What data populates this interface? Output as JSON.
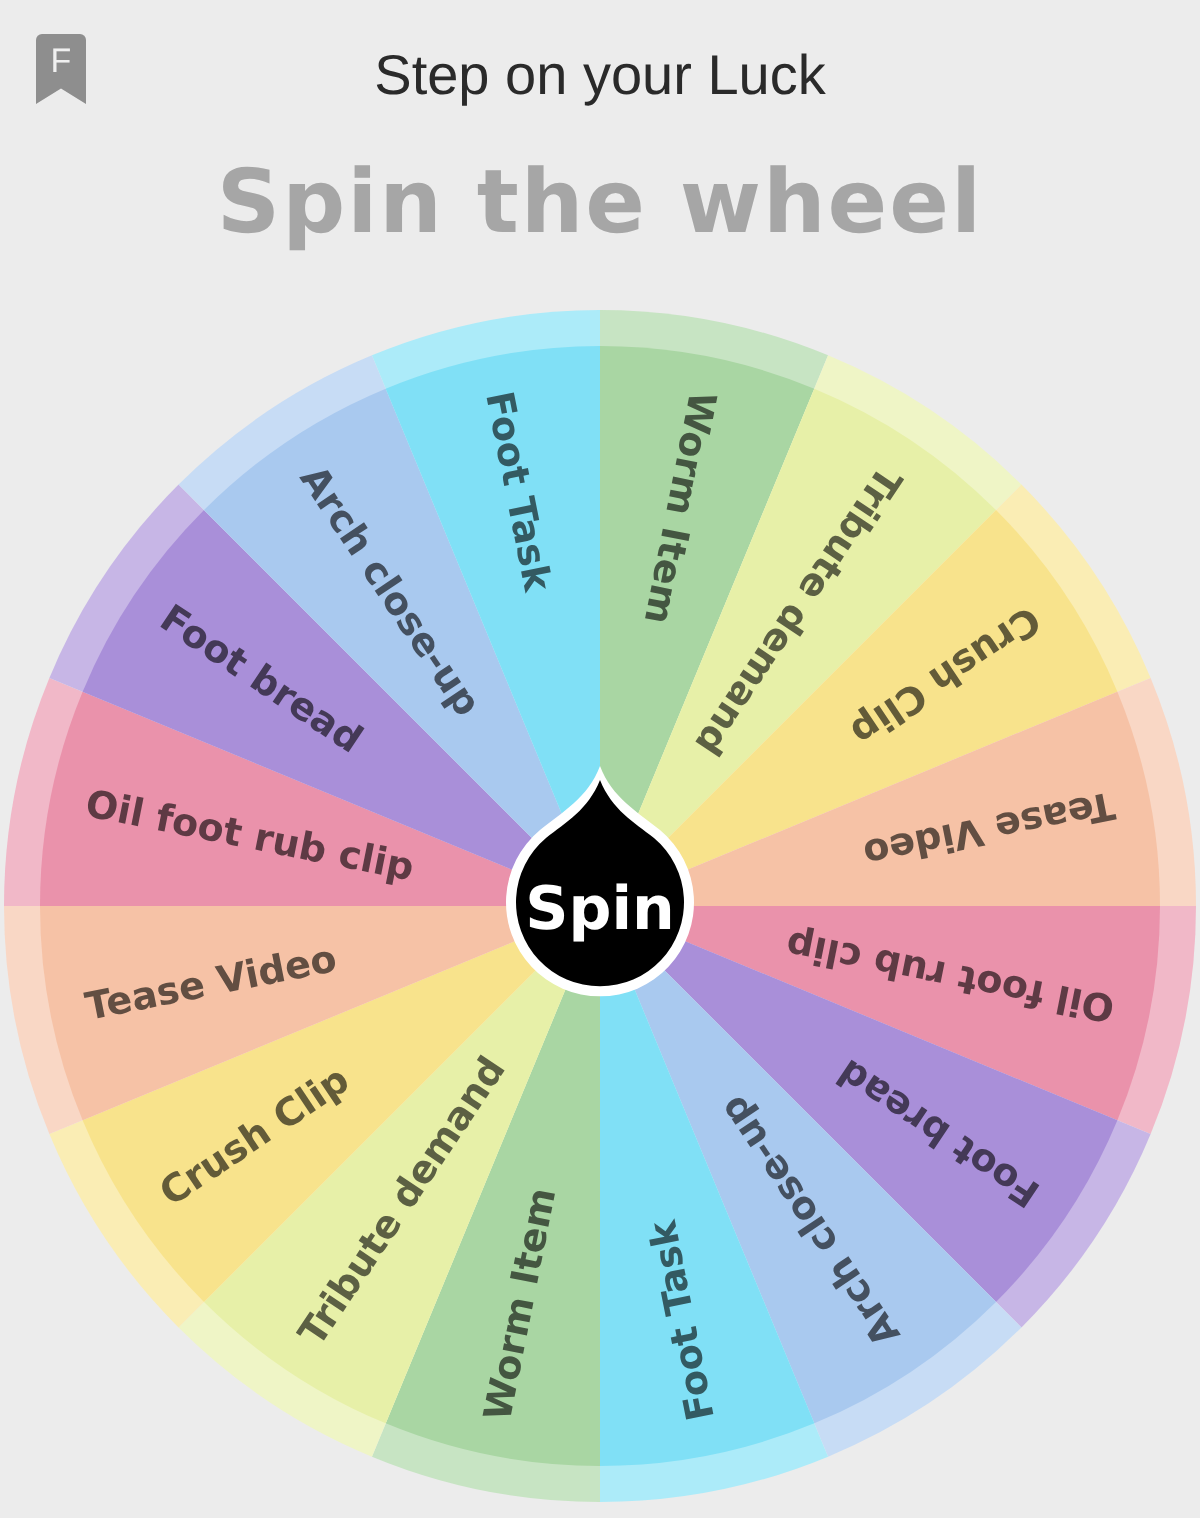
{
  "header": {
    "badge": "F",
    "title": "Step on your Luck"
  },
  "heading": "Spin the wheel",
  "wheel": {
    "button": "Spin",
    "segments": [
      {
        "label": "Worm Item",
        "color": "#a9d6a3"
      },
      {
        "label": "Tribute demand",
        "color": "#e7f0a8"
      },
      {
        "label": "Crush Clip",
        "color": "#f8e38c"
      },
      {
        "label": "Tease Video",
        "color": "#f6c2a6"
      },
      {
        "label": "Oil foot rub clip",
        "color": "#ea92ab"
      },
      {
        "label": "Foot bread",
        "color": "#a98fd9"
      },
      {
        "label": "Arch close-up",
        "color": "#a9c9ef"
      },
      {
        "label": "Foot Task",
        "color": "#80e0f6"
      },
      {
        "label": "Worm Item",
        "color": "#a9d6a3"
      },
      {
        "label": "Tribute demand",
        "color": "#e7f0a8"
      },
      {
        "label": "Crush Clip",
        "color": "#f8e38c"
      },
      {
        "label": "Tease Video",
        "color": "#f6c2a6"
      },
      {
        "label": "Oil foot rub clip",
        "color": "#ea92ab"
      },
      {
        "label": "Foot bread",
        "color": "#a98fd9"
      },
      {
        "label": "Arch close-up",
        "color": "#a9c9ef"
      },
      {
        "label": "Foot Task",
        "color": "#80e0f6"
      }
    ]
  }
}
